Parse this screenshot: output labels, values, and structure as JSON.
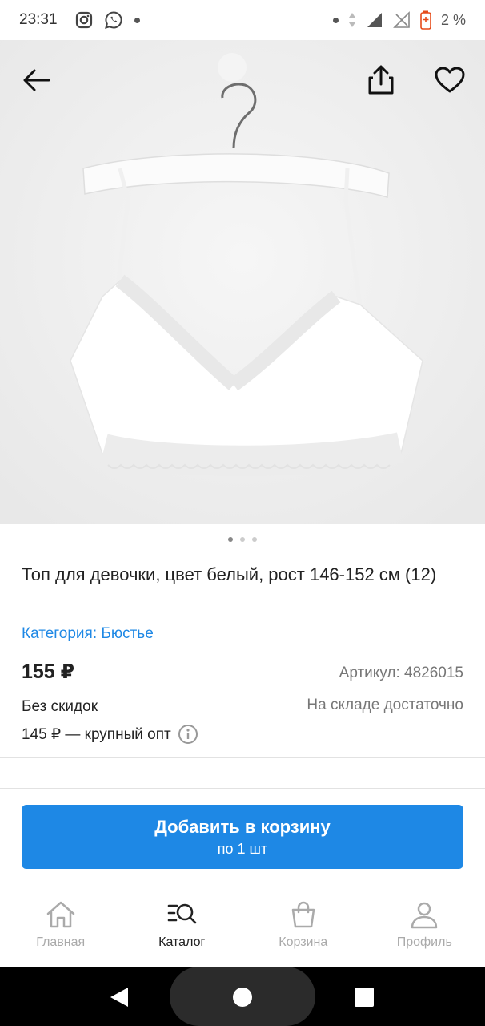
{
  "status_bar": {
    "time": "23:31",
    "battery": "2 %"
  },
  "product": {
    "title": "Топ для девочки, цвет белый, рост 146-152 см (12)",
    "category": "Категория: Бюстье",
    "price": "155 ₽",
    "sku": "Артикул: 4826015",
    "discount": "Без скидок",
    "stock": "На складе достаточно",
    "wholesale": "145 ₽ — крупный опт",
    "image_count": 3,
    "active_image": 1
  },
  "cart_button": {
    "label": "Добавить в корзину",
    "sublabel": "по 1 шт"
  },
  "bottom_nav": {
    "items": [
      {
        "label": "Главная",
        "icon": "home-icon"
      },
      {
        "label": "Каталог",
        "icon": "catalog-search-icon",
        "active": true
      },
      {
        "label": "Корзина",
        "icon": "bag-icon"
      },
      {
        "label": "Профиль",
        "icon": "profile-icon"
      }
    ]
  },
  "colors": {
    "accent": "#1e88e5",
    "inactive": "#aaaaaa"
  }
}
